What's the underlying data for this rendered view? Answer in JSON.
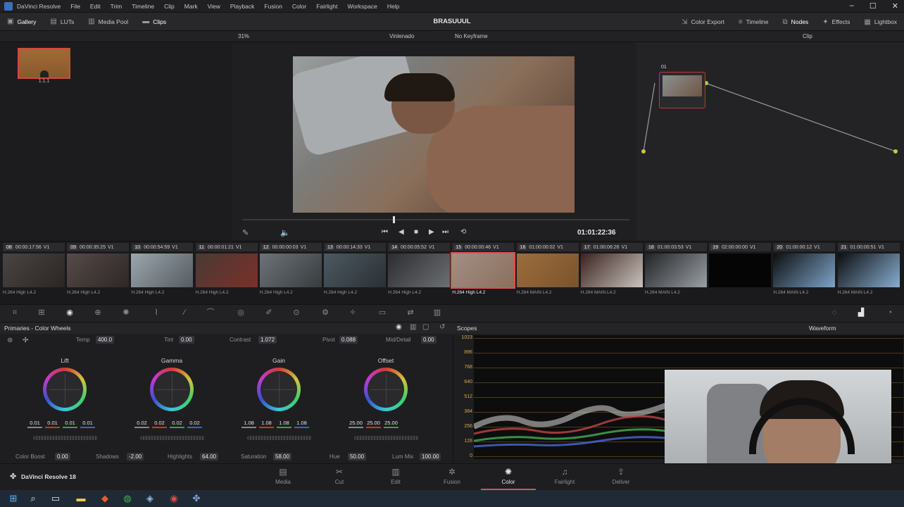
{
  "menu": [
    "DaVinci Resolve",
    "File",
    "Edit",
    "Trim",
    "Timeline",
    "Clip",
    "Mark",
    "View",
    "Playback",
    "Fusion",
    "Color",
    "Fairlight",
    "Workspace",
    "Help"
  ],
  "window_controls": [
    "–",
    "☐",
    "✕"
  ],
  "toolbar": {
    "left": [
      {
        "label": "Gallery",
        "icon": "gallery-icon"
      },
      {
        "label": "LUTs",
        "icon": "luts-icon"
      },
      {
        "label": "Media Pool",
        "icon": "media-pool-icon"
      },
      {
        "label": "Clips",
        "icon": "clips-icon"
      }
    ],
    "project_title": "BRASUUUL",
    "right": [
      {
        "label": "Color Export",
        "icon": "color-export-icon"
      },
      {
        "label": "Timeline",
        "icon": "timeline-icon"
      },
      {
        "label": "Nodes",
        "icon": "nodes-icon"
      },
      {
        "label": "Effects",
        "icon": "effects-icon"
      },
      {
        "label": "Lightbox",
        "icon": "lightbox-icon"
      }
    ]
  },
  "viewer": {
    "zoom": "31%",
    "title": "Vinlenado",
    "keyframe": "No Keyframe",
    "timecode": "01:01:22:36",
    "node_mode": "Clip"
  },
  "gallery": {
    "still_label": "1.1.1"
  },
  "node": {
    "label": "01"
  },
  "clips": [
    {
      "num": "08",
      "tc": "00:00:17:56",
      "track": "V1",
      "codec": "H.264 High L4.2",
      "c1": "#4a4443",
      "c2": "#2b2524"
    },
    {
      "num": "09",
      "tc": "00:00:35:25",
      "track": "V1",
      "codec": "H.264 High L4.2",
      "c1": "#564b47",
      "c2": "#2d2726"
    },
    {
      "num": "10",
      "tc": "00:00:54:59",
      "track": "V1",
      "codec": "H.264 High L4.2",
      "c1": "#9ca6ad",
      "c2": "#555c61"
    },
    {
      "num": "11",
      "tc": "00:00:01:21",
      "track": "V1",
      "codec": "H.264 High L4.2",
      "c1": "#4a3a35",
      "c2": "#7c2f2a"
    },
    {
      "num": "12",
      "tc": "00:00:00:03",
      "track": "V1",
      "codec": "H.264 High L4.2",
      "c1": "#6c7378",
      "c2": "#383c3f"
    },
    {
      "num": "13",
      "tc": "00:00:14:33",
      "track": "V1",
      "codec": "H.264 High L4.2",
      "c1": "#4c5861",
      "c2": "#2b3135"
    },
    {
      "num": "14",
      "tc": "00:00:05:52",
      "track": "V1",
      "codec": "H.264 High L4.2",
      "c1": "#2c2d30",
      "c2": "#6c6f73"
    },
    {
      "num": "15",
      "tc": "00:00:00:46",
      "track": "V1",
      "codec": "H.264 High L4.2",
      "c1": "#a38f86",
      "c2": "#8a6f5d",
      "selected": true
    },
    {
      "num": "16",
      "tc": "01:00:00:02",
      "track": "V1",
      "codec": "H.264 MAIN L4.2",
      "c1": "#9c6d3c",
      "c2": "#7a532c"
    },
    {
      "num": "17",
      "tc": "01:00:06:26",
      "track": "V1",
      "codec": "H.264 MAIN L4.2",
      "c1": "#3b2320",
      "c2": "#c9c3bd"
    },
    {
      "num": "18",
      "tc": "01:00:03:53",
      "track": "V1",
      "codec": "H.264 MAIN L4.2",
      "c1": "#222326",
      "c2": "#9aa0a5"
    },
    {
      "num": "19",
      "tc": "02:00:00:00",
      "track": "V1",
      "codec": "",
      "c1": "#050505",
      "c2": "#050505"
    },
    {
      "num": "20",
      "tc": "01:00:00:12",
      "track": "V1",
      "codec": "H.264 MAIN L4.2",
      "c1": "#0d0e10",
      "c2": "#7da4c8"
    },
    {
      "num": "21",
      "tc": "01:00:00:51",
      "track": "V1",
      "codec": "H.264 MAIN L4.2",
      "c1": "#0d0e10",
      "c2": "#88aed0"
    }
  ],
  "primaries": {
    "title": "Primaries - Color Wheels",
    "temp": {
      "label": "Temp",
      "value": "400.0"
    },
    "tint": {
      "label": "Tint",
      "value": "0.00"
    },
    "contrast": {
      "label": "Contrast",
      "value": "1.072"
    },
    "pivot": {
      "label": "Pivot",
      "value": "0.088"
    },
    "middetail": {
      "label": "Mid/Detail",
      "value": "0.00"
    },
    "wheels": [
      {
        "name": "Lift",
        "values": [
          "0.01",
          "0.01",
          "0.01",
          "0.01"
        ]
      },
      {
        "name": "Gamma",
        "values": [
          "0.02",
          "0.02",
          "0.02",
          "0.02"
        ]
      },
      {
        "name": "Gain",
        "values": [
          "1.08",
          "1.08",
          "1.08",
          "1.08"
        ]
      },
      {
        "name": "Offset",
        "values": [
          "25.00",
          "25.00",
          "25.00"
        ]
      }
    ],
    "bottom": [
      {
        "label": "Color Boost",
        "value": "0.00"
      },
      {
        "label": "Shadows",
        "value": "-2.00"
      },
      {
        "label": "Highlights",
        "value": "64.00"
      },
      {
        "label": "Saturation",
        "value": "58.00"
      },
      {
        "label": "Hue",
        "value": "50.00"
      },
      {
        "label": "Lum Mix",
        "value": "100.00"
      }
    ]
  },
  "scopes": {
    "title": "Scopes",
    "mode": "Waveform",
    "scale": [
      "1023",
      "896",
      "768",
      "640",
      "512",
      "384",
      "256",
      "128",
      "0"
    ]
  },
  "pages": [
    {
      "label": "Media",
      "icon": "media-page-icon"
    },
    {
      "label": "Cut",
      "icon": "cut-page-icon"
    },
    {
      "label": "Edit",
      "icon": "edit-page-icon"
    },
    {
      "label": "Fusion",
      "icon": "fusion-page-icon"
    },
    {
      "label": "Color",
      "icon": "color-page-icon",
      "active": true
    },
    {
      "label": "Fairlight",
      "icon": "fairlight-page-icon"
    },
    {
      "label": "Deliver",
      "icon": "deliver-page-icon"
    }
  ],
  "brand": "DaVinci Resolve 18",
  "colors": {
    "accent": "#d9534f",
    "scope_grid": "#d9a73c",
    "taskbar": "#202a36"
  }
}
